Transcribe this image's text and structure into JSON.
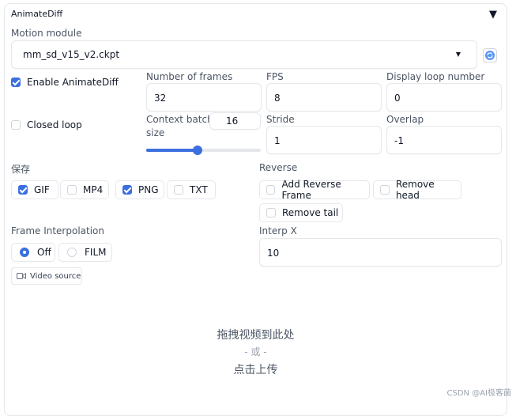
{
  "accordion": {
    "title": "AnimateDiff",
    "toggle": "▼"
  },
  "motion_module": {
    "label": "Motion module",
    "value": "mm_sd_v15_v2.ckpt",
    "caret": "▼"
  },
  "enable": {
    "label": "Enable AnimateDiff",
    "checked": true
  },
  "closed_loop": {
    "label": "Closed loop",
    "checked": false
  },
  "num_frames": {
    "label": "Number of frames",
    "value": "32"
  },
  "fps": {
    "label": "FPS",
    "value": "8"
  },
  "loop_number": {
    "label": "Display loop number",
    "value": "0"
  },
  "context_batch": {
    "label_line1": "Context batch",
    "label_line2": "size",
    "value": "16",
    "fraction": 0.45
  },
  "stride": {
    "label": "Stride",
    "value": "1"
  },
  "overlap": {
    "label": "Overlap",
    "value": "-1"
  },
  "save": {
    "label": "保存",
    "options": [
      {
        "label": "GIF",
        "checked": true
      },
      {
        "label": "MP4",
        "checked": false
      },
      {
        "label": "PNG",
        "checked": true
      },
      {
        "label": "TXT",
        "checked": false
      }
    ]
  },
  "reverse": {
    "label": "Reverse",
    "options": [
      {
        "label": "Add Reverse Frame",
        "checked": false
      },
      {
        "label": "Remove head",
        "checked": false
      },
      {
        "label": "Remove tail",
        "checked": false
      }
    ]
  },
  "interpolation": {
    "label": "Frame Interpolation",
    "options": [
      {
        "label": "Off",
        "selected": true
      },
      {
        "label": "FILM",
        "selected": false
      }
    ]
  },
  "interp_x": {
    "label": "Interp X",
    "value": "10"
  },
  "video_source": {
    "label": "Video source"
  },
  "dropzone": {
    "line1": "拖拽视频到此处",
    "line2": "- 或 -",
    "line3": "点击上传"
  },
  "watermark": "CSDN @AI极客菌",
  "colors": {
    "accent": "#3b6fe0",
    "border": "#e5e7eb"
  }
}
